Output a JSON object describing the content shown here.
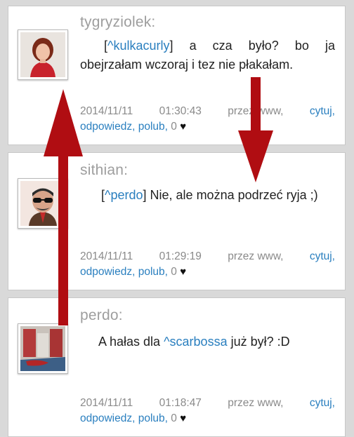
{
  "comments": [
    {
      "username": "tygryziolek:",
      "mention": "^kulkacurly",
      "text": "a cza było? bo ja obejrzałam wczoraj i tez nie płakałam.",
      "date": "2014/11/11",
      "time": "01:30:43",
      "via": "przez www,",
      "quote_label": "cytuj,",
      "reply_label": "odpowiedz,",
      "like_label": "polub,",
      "likes": "0"
    },
    {
      "username": "sithian:",
      "mention": "^perdo",
      "text": "Nie, ale można podrzeć ryja ;)",
      "date": "2014/11/11",
      "time": "01:29:19",
      "via": "przez www,",
      "quote_label": "cytuj,",
      "reply_label": "odpowiedz,",
      "like_label": "polub,",
      "likes": "0"
    },
    {
      "username": "perdo:",
      "prefix": "A hałas dla",
      "mention": "^scarbossa",
      "suffix": "już był? :D",
      "date": "2014/11/11",
      "time": "01:18:47",
      "via": "przez www,",
      "quote_label": "cytuj,",
      "reply_label": "odpowiedz,",
      "like_label": "polub,",
      "likes": "0"
    }
  ],
  "icons": {
    "like": "heart-icon",
    "arrow_color": "#b00d12"
  },
  "colors": {
    "link": "#2a7fbf",
    "username": "#9e9e9e",
    "background": "#d9d9d9"
  }
}
